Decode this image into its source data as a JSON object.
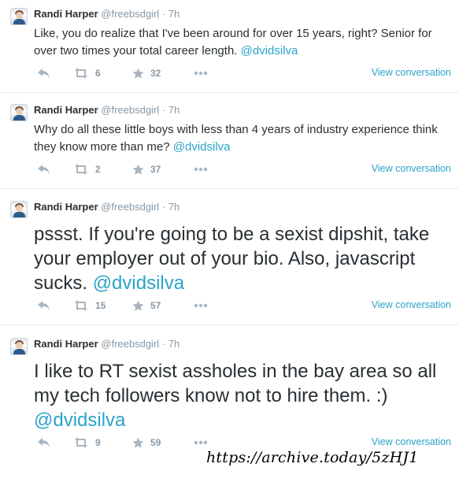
{
  "tweets": [
    {
      "name": "Randi Harper",
      "handle": "@freebsdgirl",
      "time": "· 7h",
      "text": "Like, you do realize that I've been around for over 15 years, right? Senior for over two times your total career length.",
      "mention": "@dvidsilva",
      "retweets": "6",
      "favorites": "32",
      "view_conversation": "View conversation"
    },
    {
      "name": "Randi Harper",
      "handle": "@freebsdgirl",
      "time": "· 7h",
      "text": "Why do all these little boys with less than 4 years of industry experience think they know more than me?",
      "mention": "@dvidsilva",
      "retweets": "2",
      "favorites": "37",
      "view_conversation": "View conversation"
    },
    {
      "name": "Randi Harper",
      "handle": "@freebsdgirl",
      "time": "· 7h",
      "text": "pssst. If you're going to be a sexist dipshit, take your employer out of your bio. Also, javascript sucks.",
      "mention": "@dvidsilva",
      "retweets": "15",
      "favorites": "57",
      "view_conversation": "View conversation"
    },
    {
      "name": "Randi Harper",
      "handle": "@freebsdgirl",
      "time": "· 7h",
      "text": "I like to RT sexist assholes in the bay area so all my tech followers know not to hire them. :)",
      "mention": "@dvidsilva",
      "retweets": "9",
      "favorites": "59",
      "view_conversation": "View conversation"
    }
  ],
  "icons": {
    "reply": "reply-icon",
    "retweet": "retweet-icon",
    "favorite": "star-icon",
    "more": "more-icon"
  },
  "colors": {
    "link": "#2ba3c9",
    "muted": "#8899a6",
    "text": "#292f33"
  },
  "archive_url": "https://archive.today/5zHJ1"
}
